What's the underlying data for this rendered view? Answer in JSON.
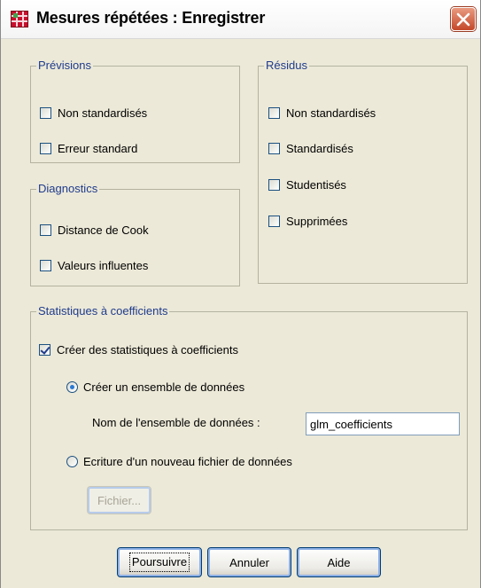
{
  "window": {
    "title": "Mesures répétées : Enregistrer",
    "close_icon": "close-icon"
  },
  "previsions": {
    "legend": "Prévisions",
    "items": [
      {
        "label": "Non standardisés",
        "checked": false
      },
      {
        "label": "Erreur standard",
        "checked": false
      }
    ]
  },
  "residus": {
    "legend": "Résidus",
    "items": [
      {
        "label": "Non standardisés",
        "checked": false
      },
      {
        "label": "Standardisés",
        "checked": false
      },
      {
        "label": "Studentisés",
        "checked": false
      },
      {
        "label": "Supprimées",
        "checked": false
      }
    ]
  },
  "diagnostics": {
    "legend": "Diagnostics",
    "items": [
      {
        "label": "Distance de Cook",
        "checked": false
      },
      {
        "label": "Valeurs influentes",
        "checked": false
      }
    ]
  },
  "coefficients": {
    "legend": "Statistiques à coefficients",
    "create_label": "Créer des statistiques à coefficients",
    "create_checked": true,
    "radio_dataset_label": "Créer un ensemble de données",
    "radio_dataset_selected": true,
    "dataset_name_label": "Nom de l'ensemble de données :",
    "dataset_name_value": "glm_coefficients",
    "radio_file_label": "Ecriture d'un nouveau fichier de données",
    "radio_file_selected": false,
    "file_button_label": "Fichier..."
  },
  "buttons": {
    "continue": "Poursuivre",
    "cancel": "Annuler",
    "help": "Aide"
  },
  "colors": {
    "dialog_bg": "#ece9d8",
    "legend_text": "#1f3b8c",
    "group_border": "#b4b29f",
    "close_button": "#c4482a"
  }
}
